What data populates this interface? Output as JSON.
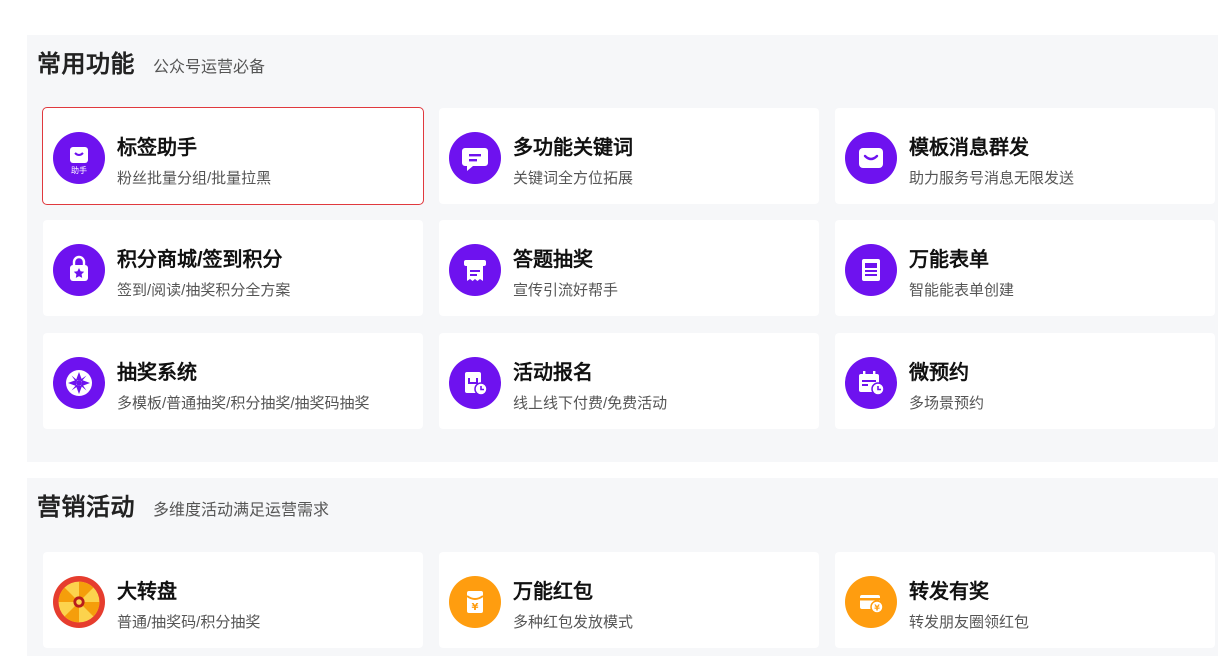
{
  "sections": [
    {
      "title": "常用功能",
      "subtitle": "公众号运营必备",
      "items": [
        {
          "title": "标签助手",
          "desc": "粉丝批量分组/批量拉黑",
          "icon": "tag-assistant-icon",
          "icon_text": "助手",
          "color": "#6e12ef",
          "selected": true
        },
        {
          "title": "多功能关键词",
          "desc": "关键词全方位拓展",
          "icon": "message-icon",
          "color": "#6e12ef"
        },
        {
          "title": "模板消息群发",
          "desc": "助力服务号消息无限发送",
          "icon": "smile-message-icon",
          "color": "#6e12ef"
        },
        {
          "title": "积分商城/签到积分",
          "desc": "签到/阅读/抽奖积分全方案",
          "icon": "shopping-bag-icon",
          "color": "#6e12ef"
        },
        {
          "title": "答题抽奖",
          "desc": "宣传引流好帮手",
          "icon": "receipt-icon",
          "color": "#6e12ef"
        },
        {
          "title": "万能表单",
          "desc": "智能能表单创建",
          "icon": "form-icon",
          "color": "#6e12ef"
        },
        {
          "title": "抽奖系统",
          "desc": "多模板/普通抽奖/积分抽奖/抽奖码抽奖",
          "icon": "lottery-wheel-icon",
          "color": "#6e12ef"
        },
        {
          "title": "活动报名",
          "desc": "线上线下付费/免费活动",
          "icon": "signup-clock-icon",
          "color": "#6e12ef"
        },
        {
          "title": "微预约",
          "desc": "多场景预约",
          "icon": "calendar-clock-icon",
          "color": "#6e12ef"
        }
      ]
    },
    {
      "title": "营销活动",
      "subtitle": "多维度活动满足运营需求",
      "items": [
        {
          "title": "大转盘",
          "desc": "普通/抽奖码/积分抽奖",
          "icon": "prize-wheel-icon",
          "color": "#e63d2e"
        },
        {
          "title": "万能红包",
          "desc": "多种红包发放模式",
          "icon": "red-envelope-icon",
          "color": "#ff9d0f"
        },
        {
          "title": "转发有奖",
          "desc": "转发朋友圈领红包",
          "icon": "card-coin-icon",
          "color": "#ff9d0f"
        }
      ]
    }
  ]
}
